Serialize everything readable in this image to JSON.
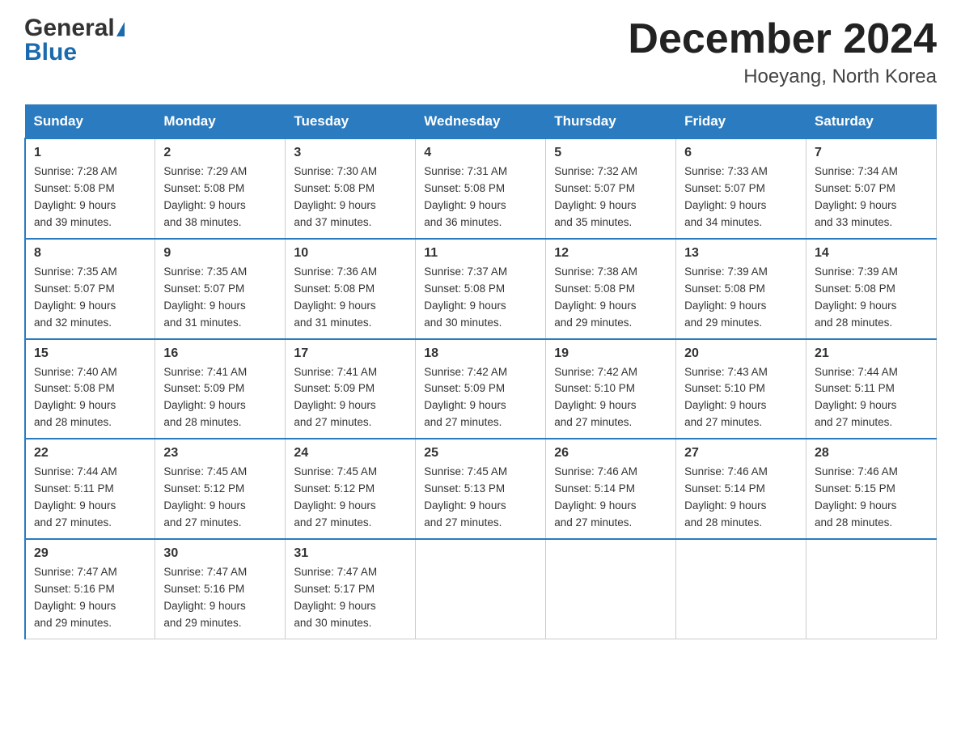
{
  "logo": {
    "general": "General",
    "blue": "Blue",
    "triangle": "▶"
  },
  "header": {
    "month_year": "December 2024",
    "location": "Hoeyang, North Korea"
  },
  "days_of_week": [
    "Sunday",
    "Monday",
    "Tuesday",
    "Wednesday",
    "Thursday",
    "Friday",
    "Saturday"
  ],
  "weeks": [
    [
      {
        "day": "1",
        "sunrise": "7:28 AM",
        "sunset": "5:08 PM",
        "daylight": "9 hours and 39 minutes."
      },
      {
        "day": "2",
        "sunrise": "7:29 AM",
        "sunset": "5:08 PM",
        "daylight": "9 hours and 38 minutes."
      },
      {
        "day": "3",
        "sunrise": "7:30 AM",
        "sunset": "5:08 PM",
        "daylight": "9 hours and 37 minutes."
      },
      {
        "day": "4",
        "sunrise": "7:31 AM",
        "sunset": "5:08 PM",
        "daylight": "9 hours and 36 minutes."
      },
      {
        "day": "5",
        "sunrise": "7:32 AM",
        "sunset": "5:07 PM",
        "daylight": "9 hours and 35 minutes."
      },
      {
        "day": "6",
        "sunrise": "7:33 AM",
        "sunset": "5:07 PM",
        "daylight": "9 hours and 34 minutes."
      },
      {
        "day": "7",
        "sunrise": "7:34 AM",
        "sunset": "5:07 PM",
        "daylight": "9 hours and 33 minutes."
      }
    ],
    [
      {
        "day": "8",
        "sunrise": "7:35 AM",
        "sunset": "5:07 PM",
        "daylight": "9 hours and 32 minutes."
      },
      {
        "day": "9",
        "sunrise": "7:35 AM",
        "sunset": "5:07 PM",
        "daylight": "9 hours and 31 minutes."
      },
      {
        "day": "10",
        "sunrise": "7:36 AM",
        "sunset": "5:08 PM",
        "daylight": "9 hours and 31 minutes."
      },
      {
        "day": "11",
        "sunrise": "7:37 AM",
        "sunset": "5:08 PM",
        "daylight": "9 hours and 30 minutes."
      },
      {
        "day": "12",
        "sunrise": "7:38 AM",
        "sunset": "5:08 PM",
        "daylight": "9 hours and 29 minutes."
      },
      {
        "day": "13",
        "sunrise": "7:39 AM",
        "sunset": "5:08 PM",
        "daylight": "9 hours and 29 minutes."
      },
      {
        "day": "14",
        "sunrise": "7:39 AM",
        "sunset": "5:08 PM",
        "daylight": "9 hours and 28 minutes."
      }
    ],
    [
      {
        "day": "15",
        "sunrise": "7:40 AM",
        "sunset": "5:08 PM",
        "daylight": "9 hours and 28 minutes."
      },
      {
        "day": "16",
        "sunrise": "7:41 AM",
        "sunset": "5:09 PM",
        "daylight": "9 hours and 28 minutes."
      },
      {
        "day": "17",
        "sunrise": "7:41 AM",
        "sunset": "5:09 PM",
        "daylight": "9 hours and 27 minutes."
      },
      {
        "day": "18",
        "sunrise": "7:42 AM",
        "sunset": "5:09 PM",
        "daylight": "9 hours and 27 minutes."
      },
      {
        "day": "19",
        "sunrise": "7:42 AM",
        "sunset": "5:10 PM",
        "daylight": "9 hours and 27 minutes."
      },
      {
        "day": "20",
        "sunrise": "7:43 AM",
        "sunset": "5:10 PM",
        "daylight": "9 hours and 27 minutes."
      },
      {
        "day": "21",
        "sunrise": "7:44 AM",
        "sunset": "5:11 PM",
        "daylight": "9 hours and 27 minutes."
      }
    ],
    [
      {
        "day": "22",
        "sunrise": "7:44 AM",
        "sunset": "5:11 PM",
        "daylight": "9 hours and 27 minutes."
      },
      {
        "day": "23",
        "sunrise": "7:45 AM",
        "sunset": "5:12 PM",
        "daylight": "9 hours and 27 minutes."
      },
      {
        "day": "24",
        "sunrise": "7:45 AM",
        "sunset": "5:12 PM",
        "daylight": "9 hours and 27 minutes."
      },
      {
        "day": "25",
        "sunrise": "7:45 AM",
        "sunset": "5:13 PM",
        "daylight": "9 hours and 27 minutes."
      },
      {
        "day": "26",
        "sunrise": "7:46 AM",
        "sunset": "5:14 PM",
        "daylight": "9 hours and 27 minutes."
      },
      {
        "day": "27",
        "sunrise": "7:46 AM",
        "sunset": "5:14 PM",
        "daylight": "9 hours and 28 minutes."
      },
      {
        "day": "28",
        "sunrise": "7:46 AM",
        "sunset": "5:15 PM",
        "daylight": "9 hours and 28 minutes."
      }
    ],
    [
      {
        "day": "29",
        "sunrise": "7:47 AM",
        "sunset": "5:16 PM",
        "daylight": "9 hours and 29 minutes."
      },
      {
        "day": "30",
        "sunrise": "7:47 AM",
        "sunset": "5:16 PM",
        "daylight": "9 hours and 29 minutes."
      },
      {
        "day": "31",
        "sunrise": "7:47 AM",
        "sunset": "5:17 PM",
        "daylight": "9 hours and 30 minutes."
      },
      null,
      null,
      null,
      null
    ]
  ],
  "labels": {
    "sunrise": "Sunrise:",
    "sunset": "Sunset:",
    "daylight": "Daylight:"
  }
}
